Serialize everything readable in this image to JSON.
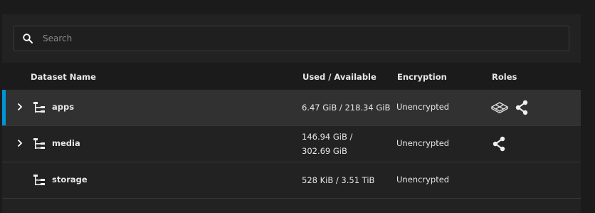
{
  "search": {
    "placeholder": "Search"
  },
  "columns": {
    "name": "Dataset Name",
    "used": "Used / Available",
    "encryption": "Encryption",
    "roles": "Roles"
  },
  "rows": [
    {
      "name": "apps",
      "used_line1": "6.47 GiB / 218.34 GiB",
      "used_line2": "",
      "encryption": "Unencrypted",
      "expandable": true,
      "selected": true,
      "roles": [
        "apps-cluster-icon",
        "share-icon"
      ]
    },
    {
      "name": "media",
      "used_line1": "146.94 GiB /",
      "used_line2": "302.69 GiB",
      "encryption": "Unencrypted",
      "expandable": true,
      "selected": false,
      "roles": [
        "share-icon"
      ]
    },
    {
      "name": "storage",
      "used_line1": "528 KiB / 3.51 TiB",
      "used_line2": "",
      "encryption": "Unencrypted",
      "expandable": false,
      "selected": false,
      "roles": []
    }
  ],
  "colors": {
    "accent": "#0095d5",
    "selected_row": "#313131",
    "background": "#222222"
  }
}
